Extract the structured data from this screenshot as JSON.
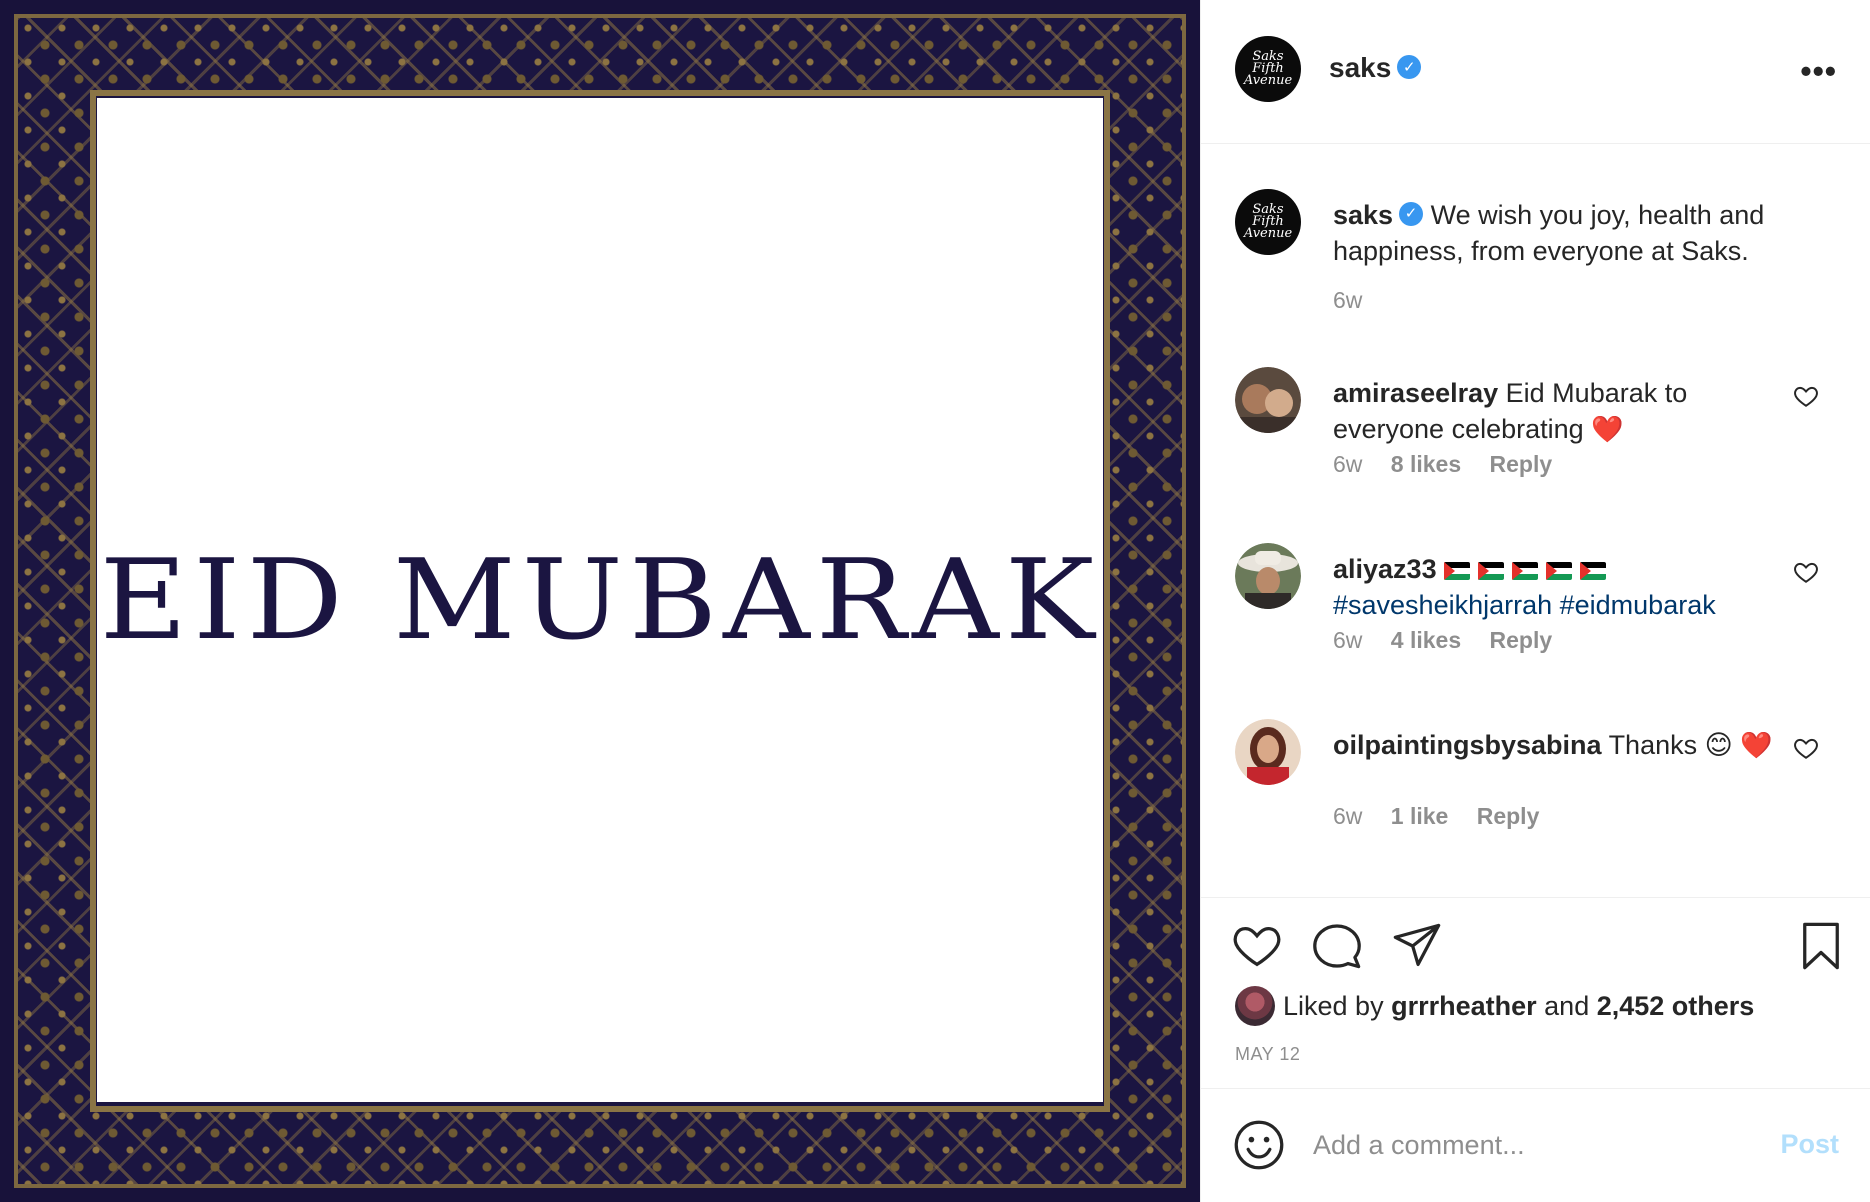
{
  "post": {
    "image_text": "EID MUBARAK"
  },
  "header": {
    "username": "saks",
    "more_label": "•••",
    "avatar_lines": [
      "Saks",
      "Fifth",
      "Avenue"
    ]
  },
  "caption": {
    "username": "saks",
    "text": "We wish you joy, health and happiness, from everyone at Saks.",
    "time": "6w"
  },
  "comments": [
    {
      "username": "amiraseelray",
      "text": "Eid Mubarak to everyone celebrating",
      "emoji": "❤️",
      "time": "6w",
      "likes": "8 likes",
      "reply": "Reply"
    },
    {
      "username": "aliyaz33",
      "flags_count": 5,
      "hashtags": "#savesheikhjarrah #eidmubarak",
      "time": "6w",
      "likes": "4 likes",
      "reply": "Reply"
    },
    {
      "username": "oilpaintingsbysabina",
      "text": "Thanks",
      "emoji_1": "😊",
      "emoji_2": "❤️",
      "time": "6w",
      "likes": "1 like",
      "reply": "Reply"
    }
  ],
  "likes": {
    "prefix": "Liked by",
    "user": "grrrheather",
    "conj": "and",
    "others": "2,452 others"
  },
  "date": "MAY 12",
  "add_comment": {
    "placeholder": "Add a comment...",
    "post_label": "Post"
  },
  "colors": {
    "verified": "#3897f0",
    "link": "#00376b",
    "post_disabled": "#b2dffc",
    "image_bg": "#1b1541",
    "ornament": "#8a7445"
  }
}
